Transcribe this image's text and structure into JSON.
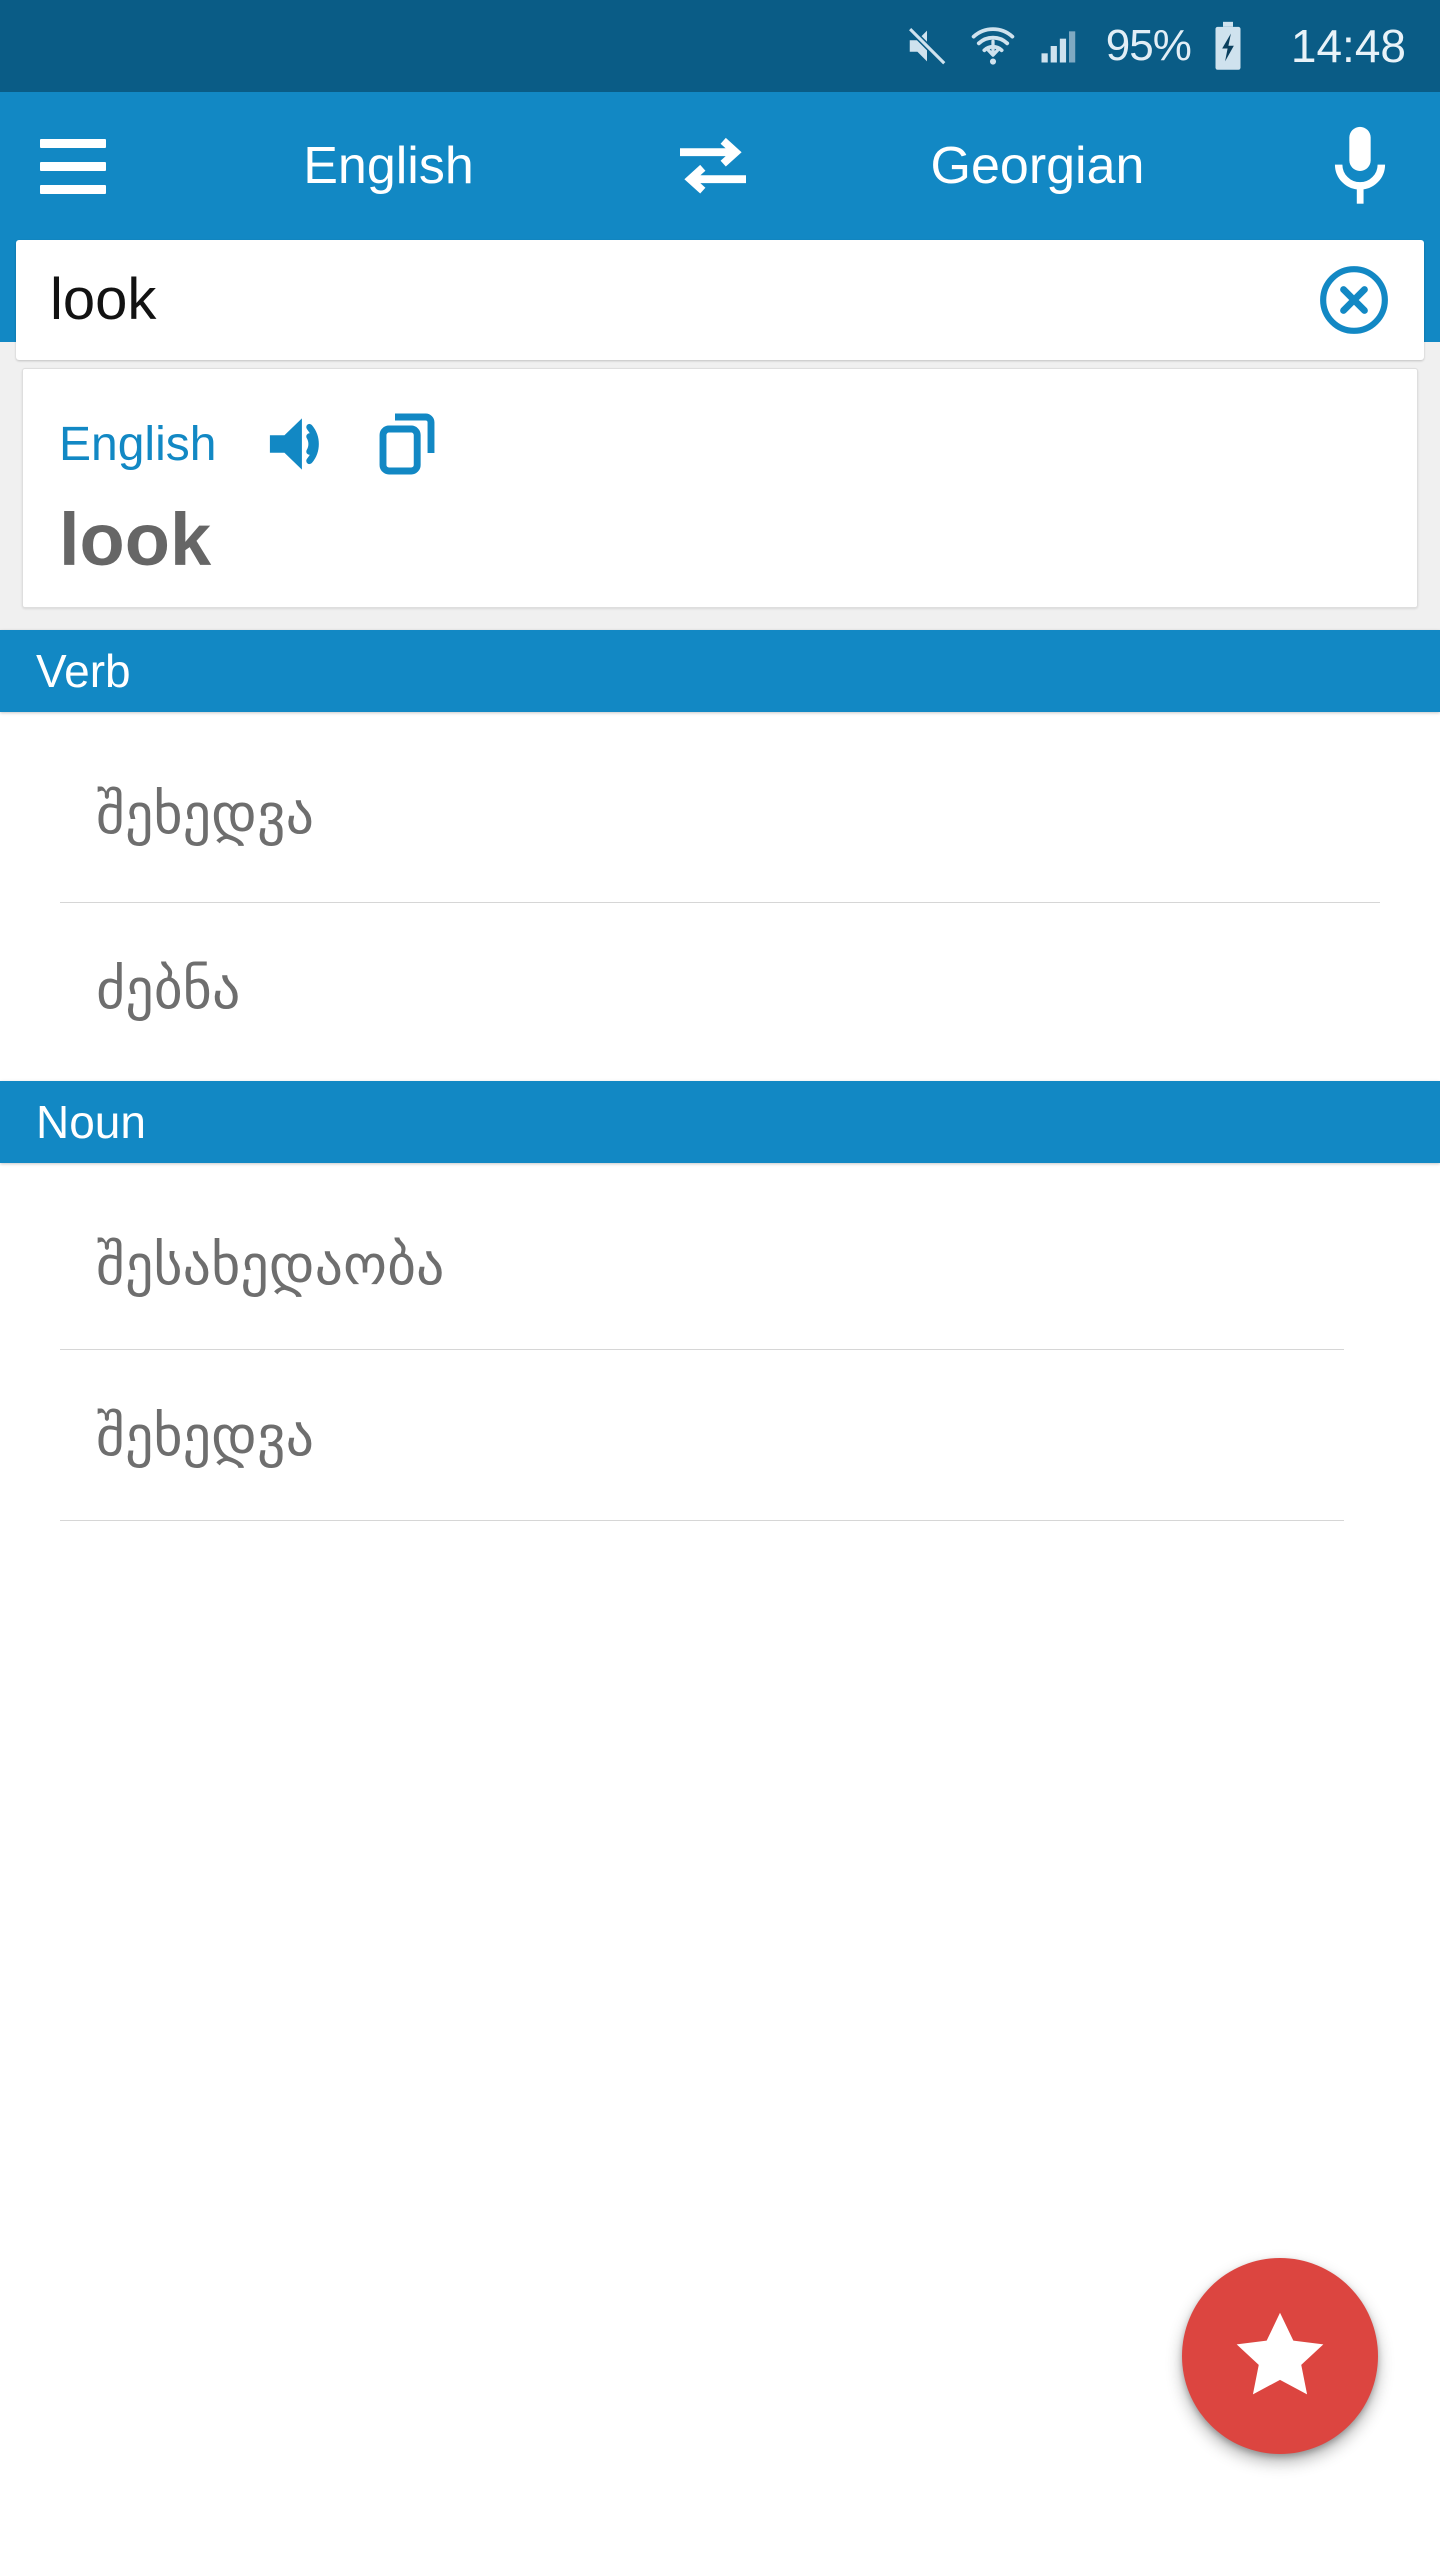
{
  "statusbar": {
    "icons": [
      "mute-icon",
      "wifi-icon",
      "signal-icon"
    ],
    "battery_percent": "95%",
    "battery_icon": "battery-charging-icon",
    "clock": "14:48"
  },
  "appbar": {
    "menu_icon": "hamburger-menu-icon",
    "source_language": "English",
    "swap_icon": "swap-horizontal-icon",
    "target_language": "Georgian",
    "mic_icon": "microphone-icon"
  },
  "search": {
    "value": "look",
    "placeholder": "",
    "clear_icon": "clear-circle-icon"
  },
  "card": {
    "language": "English",
    "speaker_icon": "speaker-icon",
    "copy_icon": "copy-icon",
    "word": "look"
  },
  "sections": [
    {
      "title": "Verb",
      "items": [
        "შეხედვა",
        "ძებნა"
      ]
    },
    {
      "title": "Noun",
      "items": [
        "შესახედაობა",
        "შეხედვა"
      ]
    }
  ],
  "fab": {
    "icon": "star-icon",
    "label": ""
  },
  "colors": {
    "status_bar": "#0a5c86",
    "app_bar": "#1288c4",
    "accent": "#1288c4",
    "fab": "#dc4540",
    "content_bg": "#f0f0f0",
    "text_gray": "#6e6e6e"
  }
}
